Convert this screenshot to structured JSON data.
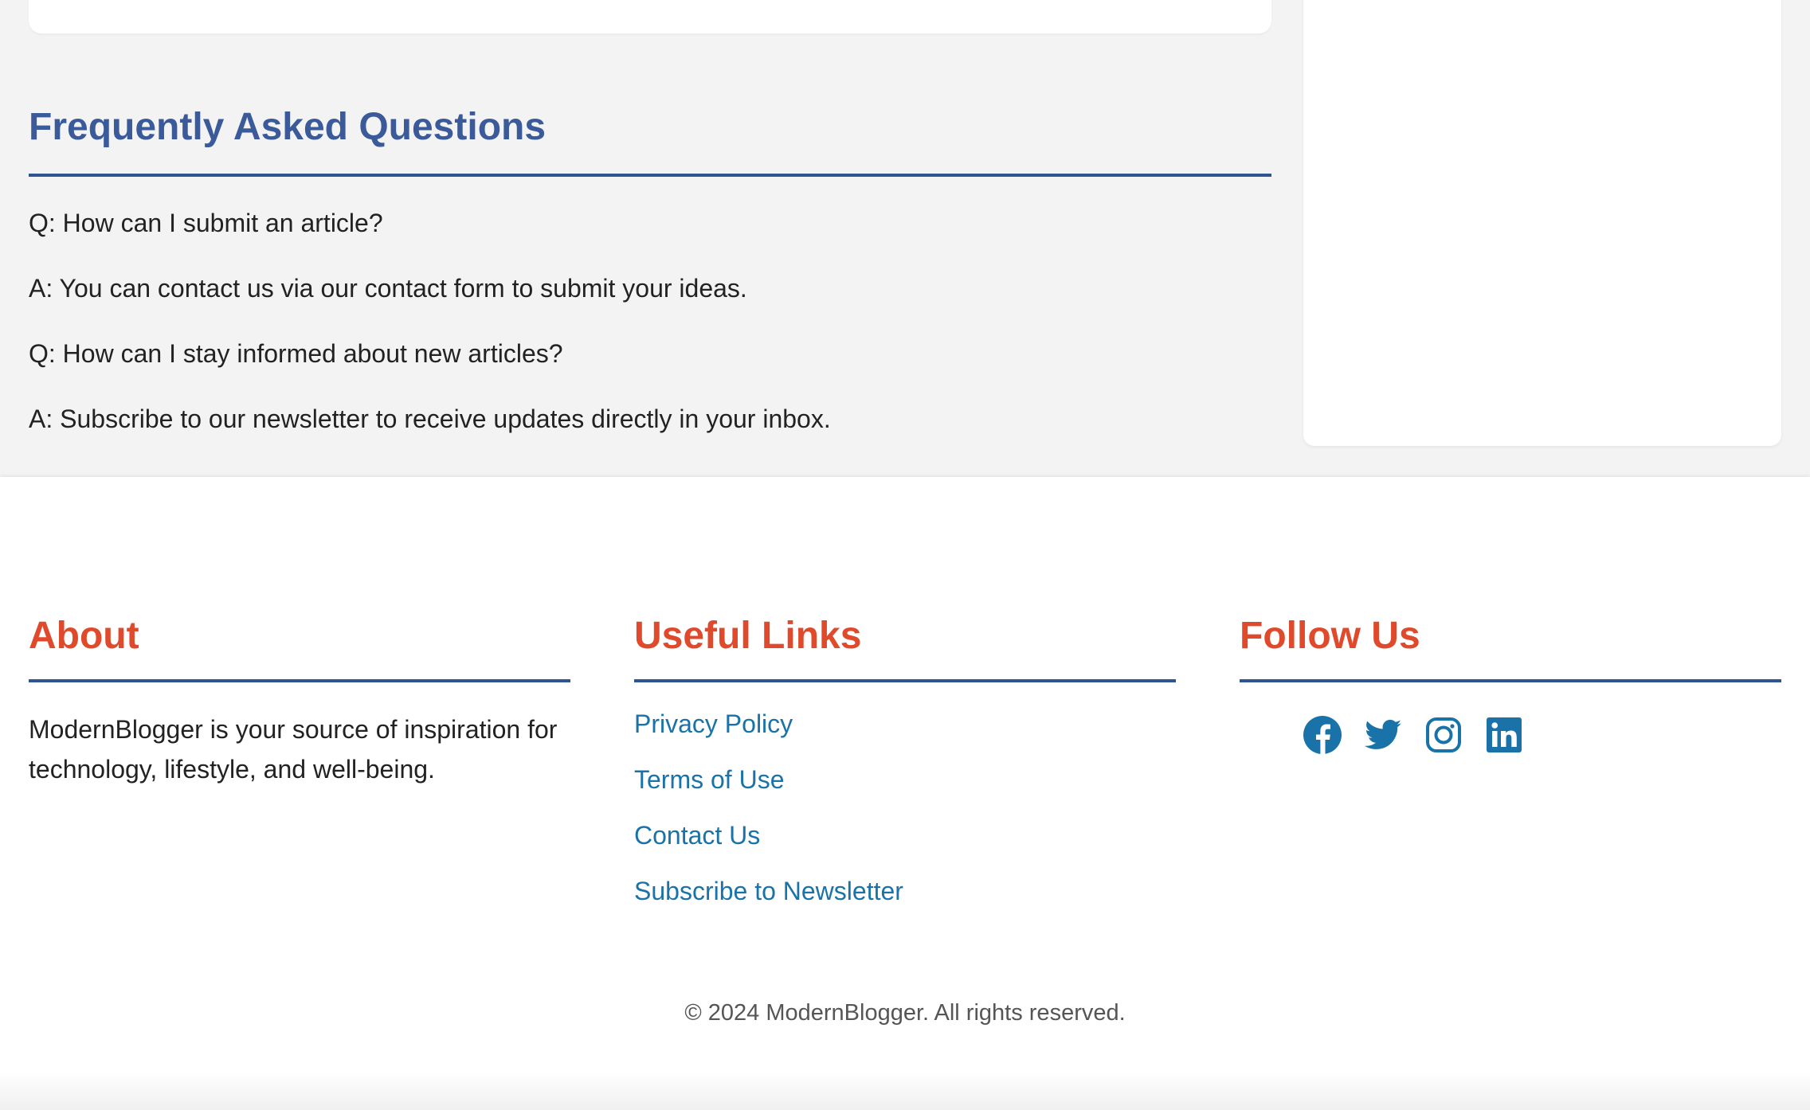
{
  "faq": {
    "title": "Frequently Asked Questions",
    "items": [
      {
        "question": "Q: How can I submit an article?",
        "answer": "A: You can contact us via our contact form to submit your ideas."
      },
      {
        "question": "Q: How can I stay informed about new articles?",
        "answer": "A: Subscribe to our newsletter to receive updates directly in your inbox."
      }
    ]
  },
  "footer": {
    "about": {
      "title": "About",
      "text": "ModernBlogger is your source of inspiration for technology, lifestyle, and well-being."
    },
    "useful_links": {
      "title": "Useful Links",
      "links": [
        "Privacy Policy",
        "Terms of Use",
        "Contact Us",
        "Subscribe to Newsletter"
      ]
    },
    "follow_us": {
      "title": "Follow Us",
      "icons": [
        "facebook-icon",
        "twitter-icon",
        "instagram-icon",
        "linkedin-icon"
      ]
    },
    "copyright": "© 2024 ModernBlogger. All rights reserved."
  },
  "colors": {
    "faq_heading": "#3a5a99",
    "footer_heading": "#e04a2c",
    "rule": "#2f5590",
    "link": "#1a73a8"
  }
}
